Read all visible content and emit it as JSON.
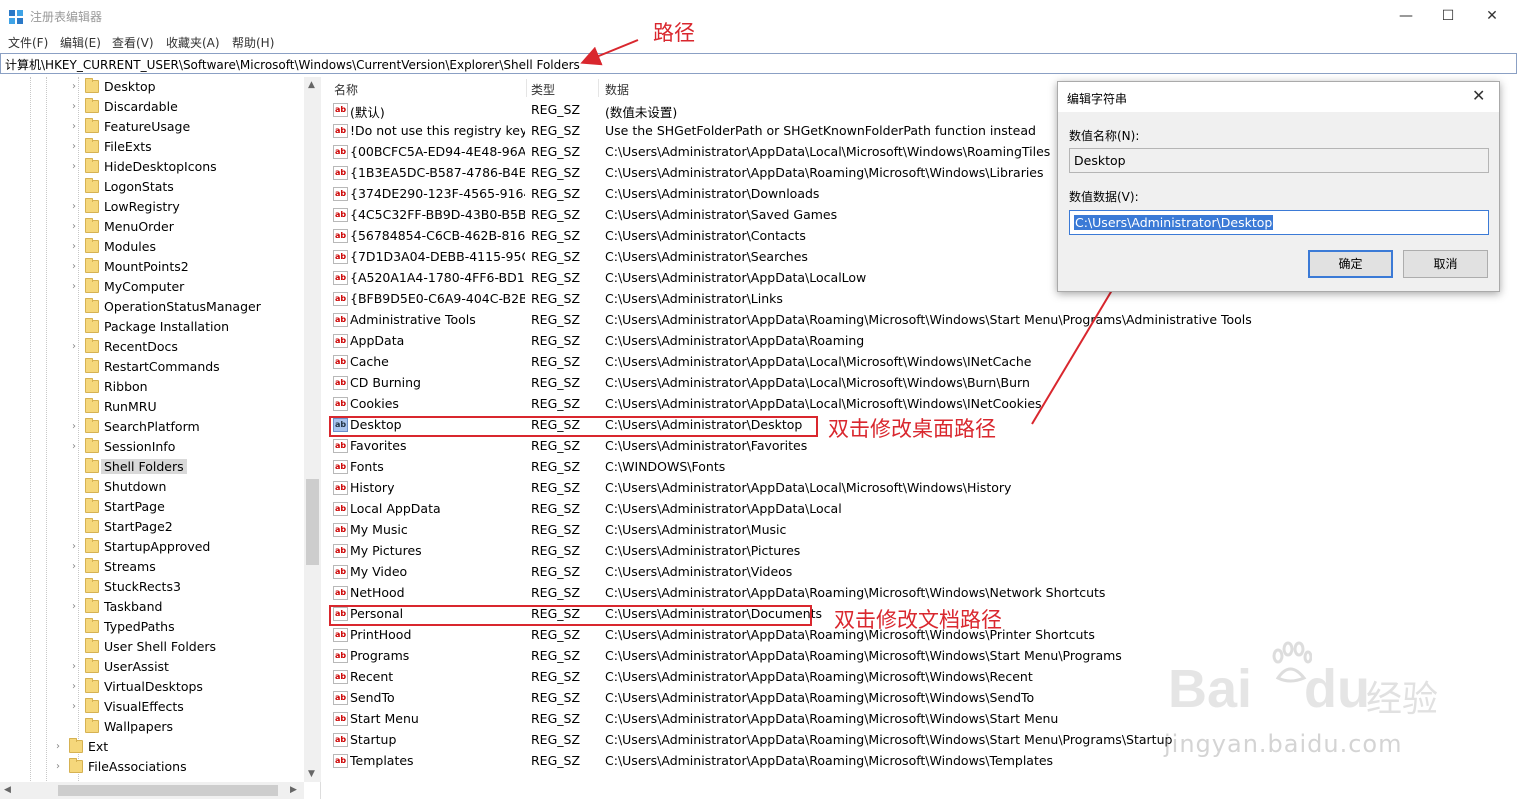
{
  "window": {
    "title": "注册表编辑器",
    "minimize": "—",
    "maximize": "☐",
    "close": "✕"
  },
  "menu": [
    "文件(F)",
    "编辑(E)",
    "查看(V)",
    "收藏夹(A)",
    "帮助(H)"
  ],
  "address": "计算机\\HKEY_CURRENT_USER\\Software\\Microsoft\\Windows\\CurrentVersion\\Explorer\\Shell Folders",
  "tree": [
    {
      "label": "Desktop",
      "expand": true
    },
    {
      "label": "Discardable",
      "expand": true
    },
    {
      "label": "FeatureUsage",
      "expand": true
    },
    {
      "label": "FileExts",
      "expand": true
    },
    {
      "label": "HideDesktopIcons",
      "expand": true
    },
    {
      "label": "LogonStats",
      "expand": false
    },
    {
      "label": "LowRegistry",
      "expand": true
    },
    {
      "label": "MenuOrder",
      "expand": true
    },
    {
      "label": "Modules",
      "expand": true
    },
    {
      "label": "MountPoints2",
      "expand": true
    },
    {
      "label": "MyComputer",
      "expand": true
    },
    {
      "label": "OperationStatusManager",
      "expand": false
    },
    {
      "label": "Package Installation",
      "expand": false
    },
    {
      "label": "RecentDocs",
      "expand": true
    },
    {
      "label": "RestartCommands",
      "expand": false
    },
    {
      "label": "Ribbon",
      "expand": false
    },
    {
      "label": "RunMRU",
      "expand": false
    },
    {
      "label": "SearchPlatform",
      "expand": true
    },
    {
      "label": "SessionInfo",
      "expand": true
    },
    {
      "label": "Shell Folders",
      "expand": false,
      "selected": true
    },
    {
      "label": "Shutdown",
      "expand": false
    },
    {
      "label": "StartPage",
      "expand": false
    },
    {
      "label": "StartPage2",
      "expand": false
    },
    {
      "label": "StartupApproved",
      "expand": true
    },
    {
      "label": "Streams",
      "expand": true
    },
    {
      "label": "StuckRects3",
      "expand": false
    },
    {
      "label": "Taskband",
      "expand": true
    },
    {
      "label": "TypedPaths",
      "expand": false
    },
    {
      "label": "User Shell Folders",
      "expand": false
    },
    {
      "label": "UserAssist",
      "expand": true
    },
    {
      "label": "VirtualDesktops",
      "expand": true
    },
    {
      "label": "VisualEffects",
      "expand": true
    },
    {
      "label": "Wallpapers",
      "expand": false
    }
  ],
  "tree_root": [
    {
      "label": "Ext",
      "expand": true
    },
    {
      "label": "FileAssociations",
      "expand": true
    }
  ],
  "columns": {
    "name": "名称",
    "type": "类型",
    "data": "数据"
  },
  "rows": [
    {
      "name": "(默认)",
      "type": "REG_SZ",
      "data": "(数值未设置)"
    },
    {
      "name": "!Do not use this registry key",
      "type": "REG_SZ",
      "data": "Use the SHGetFolderPath or SHGetKnownFolderPath function instead"
    },
    {
      "name": "{00BCFC5A-ED94-4E48-96A...",
      "type": "REG_SZ",
      "data": "C:\\Users\\Administrator\\AppData\\Local\\Microsoft\\Windows\\RoamingTiles"
    },
    {
      "name": "{1B3EA5DC-B587-4786-B4E...",
      "type": "REG_SZ",
      "data": "C:\\Users\\Administrator\\AppData\\Roaming\\Microsoft\\Windows\\Libraries"
    },
    {
      "name": "{374DE290-123F-4565-9164...",
      "type": "REG_SZ",
      "data": "C:\\Users\\Administrator\\Downloads"
    },
    {
      "name": "{4C5C32FF-BB9D-43B0-B5B...",
      "type": "REG_SZ",
      "data": "C:\\Users\\Administrator\\Saved Games"
    },
    {
      "name": "{56784854-C6CB-462B-8169...",
      "type": "REG_SZ",
      "data": "C:\\Users\\Administrator\\Contacts"
    },
    {
      "name": "{7D1D3A04-DEBB-4115-95C...",
      "type": "REG_SZ",
      "data": "C:\\Users\\Administrator\\Searches"
    },
    {
      "name": "{A520A1A4-1780-4FF6-BD18...",
      "type": "REG_SZ",
      "data": "C:\\Users\\Administrator\\AppData\\LocalLow"
    },
    {
      "name": "{BFB9D5E0-C6A9-404C-B2B...",
      "type": "REG_SZ",
      "data": "C:\\Users\\Administrator\\Links"
    },
    {
      "name": "Administrative Tools",
      "type": "REG_SZ",
      "data": "C:\\Users\\Administrator\\AppData\\Roaming\\Microsoft\\Windows\\Start Menu\\Programs\\Administrative Tools"
    },
    {
      "name": "AppData",
      "type": "REG_SZ",
      "data": "C:\\Users\\Administrator\\AppData\\Roaming"
    },
    {
      "name": "Cache",
      "type": "REG_SZ",
      "data": "C:\\Users\\Administrator\\AppData\\Local\\Microsoft\\Windows\\INetCache"
    },
    {
      "name": "CD Burning",
      "type": "REG_SZ",
      "data": "C:\\Users\\Administrator\\AppData\\Local\\Microsoft\\Windows\\Burn\\Burn"
    },
    {
      "name": "Cookies",
      "type": "REG_SZ",
      "data": "C:\\Users\\Administrator\\AppData\\Local\\Microsoft\\Windows\\INetCookies"
    },
    {
      "name": "Desktop",
      "type": "REG_SZ",
      "data": "C:\\Users\\Administrator\\Desktop",
      "selected": true
    },
    {
      "name": "Favorites",
      "type": "REG_SZ",
      "data": "C:\\Users\\Administrator\\Favorites"
    },
    {
      "name": "Fonts",
      "type": "REG_SZ",
      "data": "C:\\WINDOWS\\Fonts"
    },
    {
      "name": "History",
      "type": "REG_SZ",
      "data": "C:\\Users\\Administrator\\AppData\\Local\\Microsoft\\Windows\\History"
    },
    {
      "name": "Local AppData",
      "type": "REG_SZ",
      "data": "C:\\Users\\Administrator\\AppData\\Local"
    },
    {
      "name": "My Music",
      "type": "REG_SZ",
      "data": "C:\\Users\\Administrator\\Music"
    },
    {
      "name": "My Pictures",
      "type": "REG_SZ",
      "data": "C:\\Users\\Administrator\\Pictures"
    },
    {
      "name": "My Video",
      "type": "REG_SZ",
      "data": "C:\\Users\\Administrator\\Videos"
    },
    {
      "name": "NetHood",
      "type": "REG_SZ",
      "data": "C:\\Users\\Administrator\\AppData\\Roaming\\Microsoft\\Windows\\Network Shortcuts"
    },
    {
      "name": "Personal",
      "type": "REG_SZ",
      "data": "C:\\Users\\Administrator\\Documents"
    },
    {
      "name": "PrintHood",
      "type": "REG_SZ",
      "data": "C:\\Users\\Administrator\\AppData\\Roaming\\Microsoft\\Windows\\Printer Shortcuts"
    },
    {
      "name": "Programs",
      "type": "REG_SZ",
      "data": "C:\\Users\\Administrator\\AppData\\Roaming\\Microsoft\\Windows\\Start Menu\\Programs"
    },
    {
      "name": "Recent",
      "type": "REG_SZ",
      "data": "C:\\Users\\Administrator\\AppData\\Roaming\\Microsoft\\Windows\\Recent"
    },
    {
      "name": "SendTo",
      "type": "REG_SZ",
      "data": "C:\\Users\\Administrator\\AppData\\Roaming\\Microsoft\\Windows\\SendTo"
    },
    {
      "name": "Start Menu",
      "type": "REG_SZ",
      "data": "C:\\Users\\Administrator\\AppData\\Roaming\\Microsoft\\Windows\\Start Menu"
    },
    {
      "name": "Startup",
      "type": "REG_SZ",
      "data": "C:\\Users\\Administrator\\AppData\\Roaming\\Microsoft\\Windows\\Start Menu\\Programs\\Startup"
    },
    {
      "name": "Templates",
      "type": "REG_SZ",
      "data": "C:\\Users\\Administrator\\AppData\\Roaming\\Microsoft\\Windows\\Templates"
    }
  ],
  "annotations": {
    "path": "路径",
    "desktop": "双击修改桌面路径",
    "documents": "双击修改文档路径",
    "color": "#d9272e"
  },
  "dialog": {
    "title": "编辑字符串",
    "close": "✕",
    "name_label": "数值名称(N):",
    "name_value": "Desktop",
    "data_label": "数值数据(V):",
    "data_value": "C:\\Users\\Administrator\\Desktop",
    "ok": "确定",
    "cancel": "取消"
  },
  "watermark": {
    "brand": "Bai",
    "brand2": "du",
    "cn": "经验",
    "url": "jingyan.baidu.com"
  }
}
